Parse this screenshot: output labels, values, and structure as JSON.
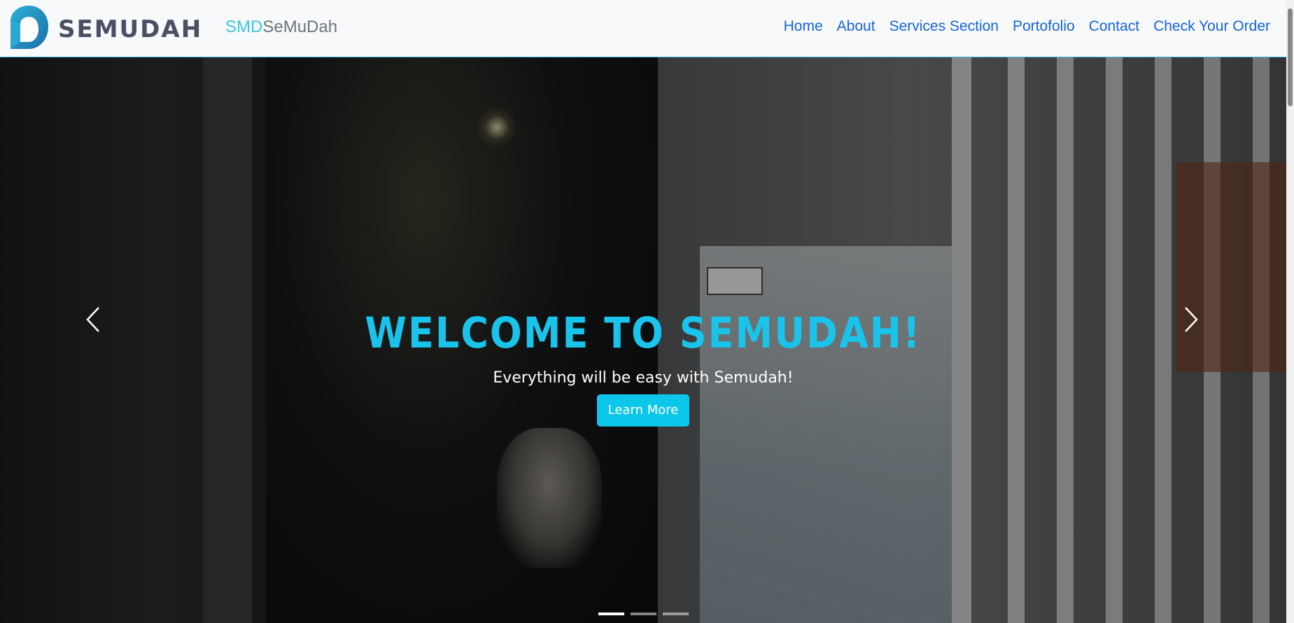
{
  "navbar": {
    "logo_text": "SEMUDAH",
    "brand_accent": "SMD",
    "brand_rest": "SeMuDah",
    "links": [
      "Home",
      "About",
      "Services Section",
      "Portofolio",
      "Contact",
      "Check Your Order"
    ]
  },
  "hero": {
    "title": "WELCOME TO SEMUDAH!",
    "subtitle": "Everything will be easy with Semudah!",
    "button_label": "Learn More",
    "slides_count": 3,
    "active_slide": 1
  },
  "colors": {
    "accent": "#19c3ea",
    "nav_link": "#1565d8",
    "brand_gray": "#6c757d",
    "logo_text": "#4a5063"
  },
  "icons": {
    "prev": "chevron-left-icon",
    "next": "chevron-right-icon"
  }
}
